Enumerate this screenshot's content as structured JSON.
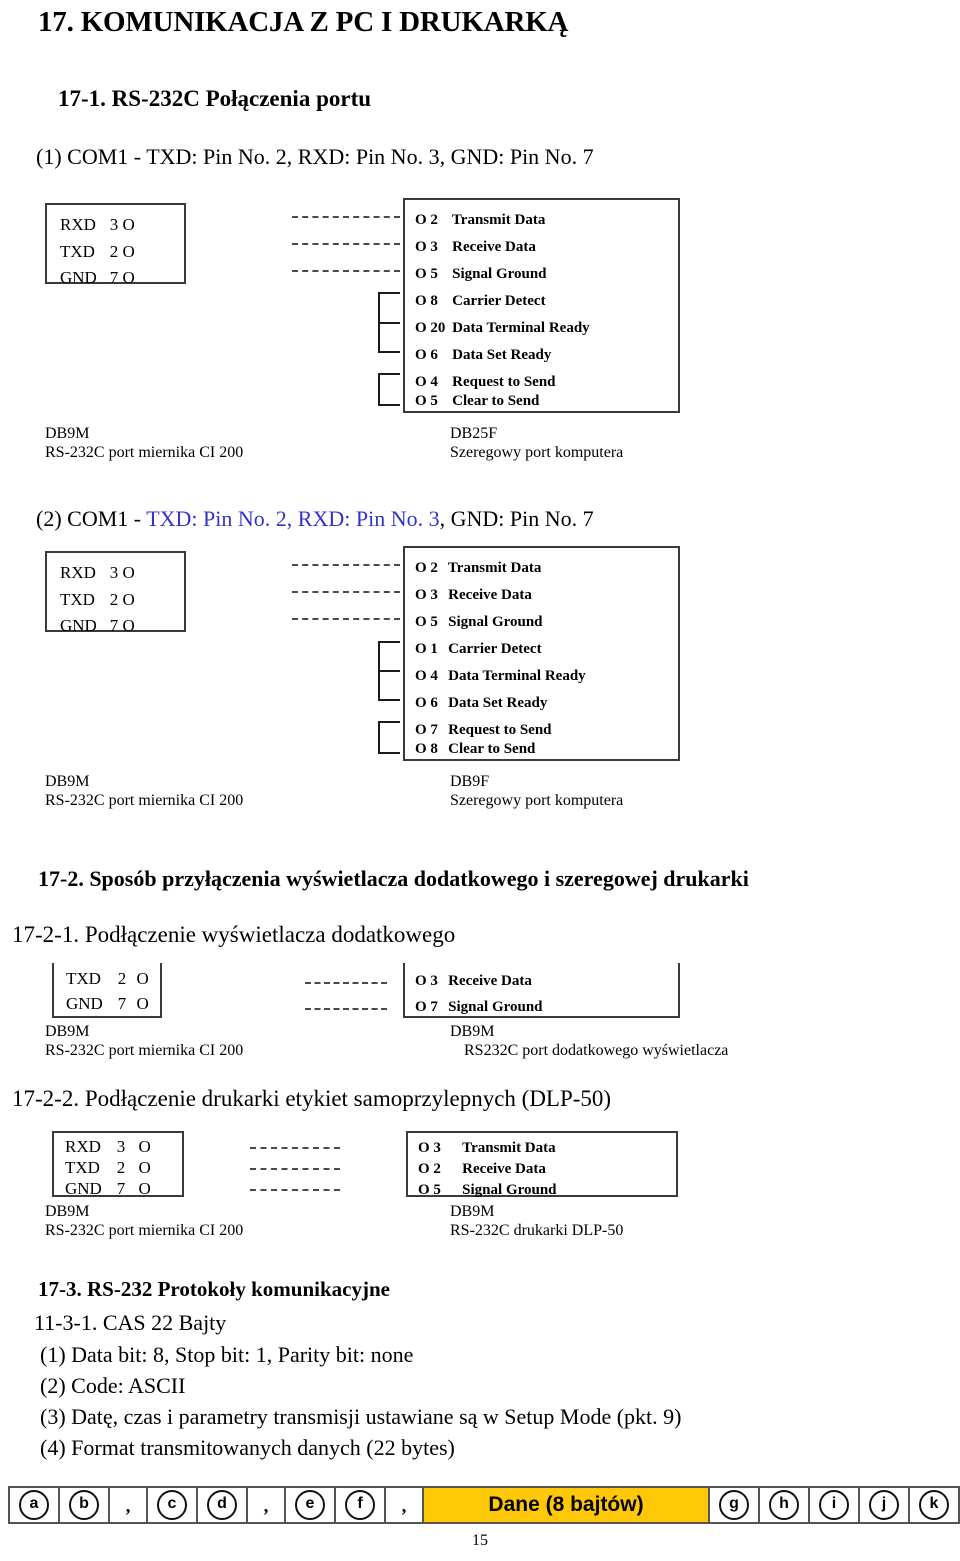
{
  "document": {
    "chapter_title": "17. KOMUNIKACJA Z PC I DRUKARKĄ",
    "page_number": "15"
  },
  "section_17_1": {
    "title": "17-1. RS-232C Połączenia portu",
    "conn1": {
      "heading_prefix": "(1) COM1 - TXD: Pin No. 2, RXD: Pin No. 3, GND: Pin No. 7",
      "left_pins": [
        {
          "label": "RXD",
          "num": "3",
          "circle": "O"
        },
        {
          "label": "TXD",
          "num": "2",
          "circle": "O"
        },
        {
          "label": "GND",
          "num": "7",
          "circle": "O"
        }
      ],
      "right_signals": [
        {
          "circle": "O",
          "pin": "2",
          "name": "Transmit Data"
        },
        {
          "circle": "O",
          "pin": "3",
          "name": "Receive Data"
        },
        {
          "circle": "O",
          "pin": "5",
          "name": "Signal Ground"
        },
        {
          "circle": "O",
          "pin": "8",
          "name": "Carrier Detect"
        },
        {
          "circle": "O",
          "pin": "20",
          "name": "Data Terminal Ready"
        },
        {
          "circle": "O",
          "pin": "6",
          "name": "Data Set Ready"
        },
        {
          "circle": "O",
          "pin": "4",
          "name": "Request to Send"
        },
        {
          "circle": "O",
          "pin": "5",
          "name": "Clear to Send"
        }
      ],
      "left_caption_1": "DB9M",
      "left_caption_2": "RS-232C port miernika CI 200",
      "right_caption_1": "DB25F",
      "right_caption_2": "Szeregowy port komputera"
    },
    "conn2": {
      "heading_a": "(2) COM1 - ",
      "heading_b": "TXD: Pin No. 2, RXD: Pin No. 3",
      "heading_c": ", GND: Pin No. 7",
      "left_pins": [
        {
          "label": "RXD",
          "num": "3",
          "circle": "O"
        },
        {
          "label": "TXD",
          "num": "2",
          "circle": "O"
        },
        {
          "label": "GND",
          "num": "7",
          "circle": "O"
        }
      ],
      "right_signals": [
        {
          "circle": "O",
          "pin": "2",
          "name": "Transmit Data"
        },
        {
          "circle": "O",
          "pin": "3",
          "name": "Receive Data"
        },
        {
          "circle": "O",
          "pin": "5",
          "name": "Signal Ground"
        },
        {
          "circle": "O",
          "pin": "1",
          "name": "Carrier Detect"
        },
        {
          "circle": "O",
          "pin": "4",
          "name": "Data Terminal Ready"
        },
        {
          "circle": "O",
          "pin": "6",
          "name": "Data Set Ready"
        },
        {
          "circle": "O",
          "pin": "7",
          "name": "Request to Send"
        },
        {
          "circle": "O",
          "pin": "8",
          "name": "Clear to Send"
        }
      ],
      "left_caption_1": "DB9M",
      "left_caption_2": "RS-232C port miernika CI 200",
      "right_caption_1": "DB9F",
      "right_caption_2": "Szeregowy port komputera"
    }
  },
  "section_17_2": {
    "title": "17-2. Sposób przyłączenia wyświetlacza dodatkowego i szeregowej drukarki",
    "sub1": {
      "title": "17-2-1. Podłączenie wyświetlacza dodatkowego",
      "left_pins": [
        {
          "label": "TXD",
          "num": "2",
          "circle": "O"
        },
        {
          "label": "GND",
          "num": "7",
          "circle": "O"
        }
      ],
      "right_signals": [
        {
          "circle": "O",
          "pin": "3",
          "name": "Receive Data"
        },
        {
          "circle": "O",
          "pin": "7",
          "name": "Signal Ground"
        }
      ],
      "left_caption_1": "DB9M",
      "left_caption_2": "RS-232C port miernika CI 200",
      "right_caption_1": "DB9M",
      "right_caption_2": "RS232C port dodatkowego wyświetlacza"
    },
    "sub2": {
      "title": "17-2-2. Podłączenie drukarki etykiet samoprzylepnych (DLP-50)",
      "left_pins": [
        {
          "label": "RXD",
          "num": "3",
          "circle": "O"
        },
        {
          "label": "TXD",
          "num": "2",
          "circle": "O"
        },
        {
          "label": "GND",
          "num": "7",
          "circle": "O"
        }
      ],
      "right_signals": [
        {
          "circle": "O",
          "pin": "3",
          "name": "Transmit Data"
        },
        {
          "circle": "O",
          "pin": "2",
          "name": "Receive Data"
        },
        {
          "circle": "O",
          "pin": "5",
          "name": "Signal Ground"
        }
      ],
      "left_caption_1": "DB9M",
      "left_caption_2": "RS-232C port miernika CI 200",
      "right_caption_1": "DB9M",
      "right_caption_2": "RS-232C drukarki DLP-50"
    }
  },
  "section_17_3": {
    "title": "17-3. RS-232 Protokoły komunikacyjne",
    "subtitle": "11-3-1. CAS 22 Bajty",
    "lines": [
      "(1) Data bit: 8, Stop bit: 1, Parity bit: none",
      "(2) Code: ASCII",
      "(3) Datę, czas i parametry transmisji ustawiane są w  Setup Mode (pkt. 9)",
      "(4) Format transmitowanych danych (22 bytes)"
    ]
  },
  "byte_format": {
    "data_cell_label": "Dane (8 bajtów)",
    "data_cell_color": "#FFC806",
    "cells": [
      {
        "type": "letter",
        "text": "a"
      },
      {
        "type": "letter",
        "text": "b"
      },
      {
        "type": "comma",
        "text": ","
      },
      {
        "type": "letter",
        "text": "c"
      },
      {
        "type": "letter",
        "text": "d"
      },
      {
        "type": "comma",
        "text": ","
      },
      {
        "type": "letter",
        "text": "e"
      },
      {
        "type": "letter",
        "text": "f"
      },
      {
        "type": "comma",
        "text": ","
      },
      {
        "type": "data",
        "text": "Dane (8 bajtów)"
      },
      {
        "type": "letter",
        "text": "g"
      },
      {
        "type": "letter",
        "text": "h"
      },
      {
        "type": "letter",
        "text": "i"
      },
      {
        "type": "letter",
        "text": "j"
      },
      {
        "type": "letter",
        "text": "k"
      }
    ]
  }
}
